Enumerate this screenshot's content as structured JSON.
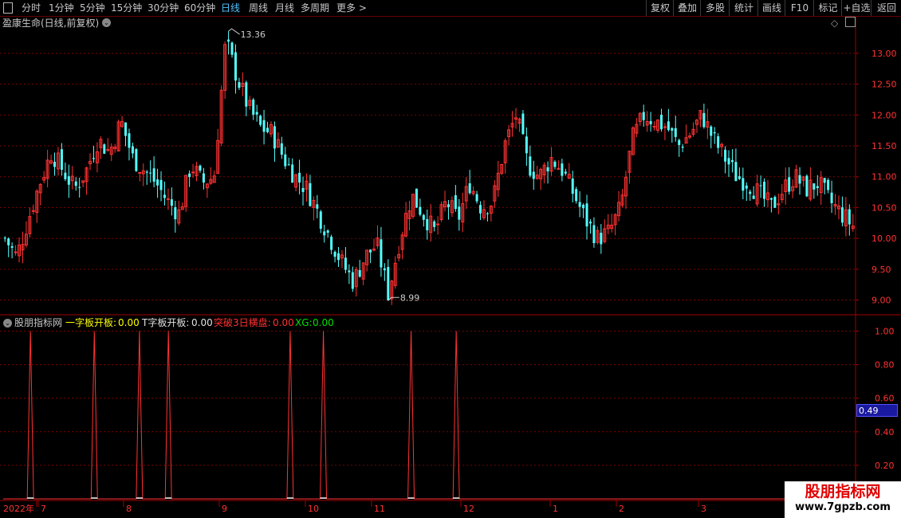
{
  "toolbar": {
    "periods": [
      "分时",
      "1分钟",
      "5分钟",
      "15分钟",
      "30分钟",
      "60分钟",
      "日线",
      "周线",
      "月线",
      "多周期",
      "更多 >"
    ],
    "active_period": "日线",
    "actions": [
      "复权",
      "叠加",
      "多股",
      "统计",
      "画线",
      "F10",
      "标记",
      "+自选",
      "返回"
    ]
  },
  "main_panel": {
    "title": "盈康生命(日线,前复权)",
    "high_label": "13.36",
    "low_label": "8.99",
    "y_ticks": [
      "13.00",
      "12.50",
      "12.00",
      "11.50",
      "11.00",
      "10.50",
      "10.00",
      "9.50",
      "9.00"
    ]
  },
  "indicator_panel": {
    "name": "股朋指标网",
    "items": [
      {
        "label": "一字板开板:",
        "value": "0.00",
        "color": "#ffff00"
      },
      {
        "label": "T字板开板:",
        "value": "0.00",
        "color": "#e0e0e0"
      },
      {
        "label": "突破3日横盘:",
        "value": "0.00",
        "color": "#ff3030"
      },
      {
        "label": "XG:",
        "value": "0.00",
        "color": "#00e000"
      }
    ],
    "y_ticks": [
      "1.00",
      "0.80",
      "0.60",
      "0.40",
      "0.20"
    ],
    "cursor_value": "0.49"
  },
  "x_axis": {
    "labels": [
      "2022年",
      "7",
      "8",
      "9",
      "10",
      "11",
      "12",
      "1",
      "2",
      "3"
    ]
  },
  "watermark": {
    "title": "股朋指标网",
    "url": "www.7gpzb.com"
  },
  "colors": {
    "up": "#ff3232",
    "down": "#54ffff",
    "grid": "#7a0000",
    "axis": "#a00000"
  },
  "chart_data": {
    "type": "candlestick",
    "title": "盈康生命(日线,前复权)",
    "ylim": [
      8.8,
      13.4
    ],
    "high": 13.36,
    "low": 8.99,
    "close_path": [
      10.0,
      9.7,
      10.3,
      10.9,
      11.4,
      11.1,
      10.8,
      11.1,
      11.6,
      11.4,
      11.9,
      11.3,
      11.1,
      10.9,
      10.6,
      10.4,
      11.2,
      10.9,
      11.0,
      13.2,
      12.6,
      12.1,
      11.8,
      11.7,
      11.3,
      11.0,
      10.8,
      10.4,
      10.0,
      9.6,
      9.3,
      9.7,
      9.9,
      9.1,
      10.0,
      10.7,
      10.4,
      10.1,
      10.6,
      10.3,
      10.9,
      10.5,
      10.6,
      11.5,
      12.0,
      11.2,
      11.0,
      11.3,
      11.1,
      10.7,
      10.3,
      10.0,
      10.1,
      10.5,
      11.6,
      12.0,
      11.9,
      11.8,
      11.5,
      11.7,
      12.0,
      11.6,
      11.3,
      11.0,
      10.9,
      10.7,
      10.5,
      10.8,
      11.0,
      10.8,
      10.9,
      10.6,
      10.4,
      10.2
    ],
    "indicator": {
      "name": "股朋指标网",
      "series": [
        {
          "name": "一字板开板",
          "last": 0.0
        },
        {
          "name": "T字板开板",
          "last": 0.0
        },
        {
          "name": "突破3日横盘",
          "last": 0.0
        },
        {
          "name": "XG",
          "last": 0.0
        }
      ],
      "signal_count": 9,
      "ylim": [
        0,
        1.05
      ]
    }
  }
}
